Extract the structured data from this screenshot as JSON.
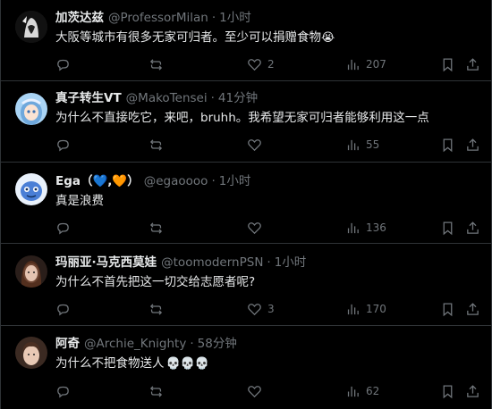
{
  "tweets": [
    {
      "name": "加茨达兹",
      "handle": "@ProfessorMilan",
      "time": "1小时",
      "text": "大阪等城市有很多无家可归者。至少可以捐赠食物",
      "emoji": "😭",
      "likes": "2",
      "views": "207",
      "replies": "",
      "retweets": ""
    },
    {
      "name": "真子转生VT",
      "handle": "@MakoTensei",
      "time": "41分钟",
      "text": "为什么不直接吃它，来吧，bruhh。我希望无家可归者能够利用这一点",
      "likes": "",
      "views": "55",
      "replies": "",
      "retweets": ""
    },
    {
      "name": "Ega（💙,🧡）",
      "handle": "@egaoooo",
      "time": "1小时",
      "text": "真是浪费",
      "likes": "",
      "views": "136",
      "replies": "",
      "retweets": ""
    },
    {
      "name": "玛丽亚·马克西莫娃",
      "handle": "@toomodernPSN",
      "time": "1小时",
      "text": "为什么不首先把这一切交给志愿者呢?",
      "likes": "3",
      "views": "170",
      "replies": "",
      "retweets": ""
    },
    {
      "name": "阿奇",
      "handle": "@Archie_Knighty",
      "time": "58分钟",
      "text": "为什么不把食物送人",
      "emoji": "💀💀💀",
      "likes": "",
      "views": "62",
      "replies": "",
      "retweets": ""
    }
  ],
  "separator": "·",
  "icons": {
    "reply": "reply-icon",
    "retweet": "retweet-icon",
    "like": "heart-icon",
    "views": "views-chart-icon",
    "bookmark": "bookmark-icon",
    "share": "share-icon"
  },
  "colors": {
    "background": "#000000",
    "text": "#e7e9ea",
    "muted": "#71767b",
    "border": "#2f3336"
  }
}
